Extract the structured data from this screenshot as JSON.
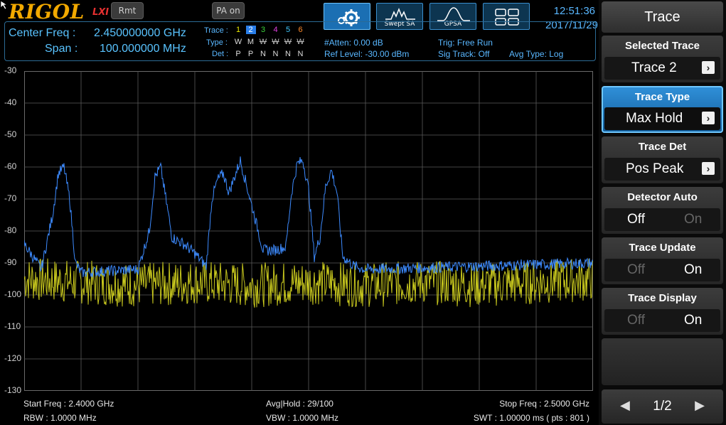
{
  "header": {
    "brand": "RIGOL",
    "lxi": "LXI",
    "rmt_label": "Rmt",
    "pa_label": "PA on",
    "modes": [
      {
        "label": "",
        "icon": "gear-icon"
      },
      {
        "label": "Swept SA",
        "icon": "swept-sa-icon"
      },
      {
        "label": "GPSA",
        "icon": "gpsa-icon"
      },
      {
        "label": "",
        "icon": "layout-icon"
      }
    ],
    "time": "12:51:36",
    "date": "2017/11/29"
  },
  "info": {
    "center_freq_label": "Center Freq :",
    "center_freq_value": "2.450000000 GHz",
    "span_label": "Span :",
    "span_value": "100.000000 MHz",
    "trace_label": "Trace :",
    "type_label": "Type :",
    "det_label": "Det :",
    "trace_numbers": [
      "1",
      "2",
      "3",
      "4",
      "5",
      "6"
    ],
    "trace_colors": [
      "#e8e800",
      "#2a7ee8",
      "#3bd43b",
      "#e040e0",
      "#40c8ff",
      "#ff8a2a"
    ],
    "selected_trace_index": 1,
    "types": [
      "W",
      "M",
      "W",
      "W",
      "W",
      "W"
    ],
    "type_struck": [
      false,
      false,
      true,
      true,
      true,
      true
    ],
    "dets": [
      "P",
      "P",
      "N",
      "N",
      "N",
      "N"
    ],
    "atten": "#Atten: 0.00 dB",
    "ref_level": "Ref Level: -30.00 dBm",
    "trig": "Trig: Free Run",
    "sig_track": "Sig Track: Off",
    "avg_type": "Avg Type: Log"
  },
  "plot": {
    "y_labels": [
      "-30",
      "-40",
      "-50",
      "-60",
      "-70",
      "-80",
      "-90",
      "-100",
      "-110",
      "-120",
      "-130"
    ]
  },
  "footer": {
    "start_freq": "Start Freq : 2.4000 GHz",
    "rbw": "RBW : 1.0000 MHz",
    "avg_hold": "Avg|Hold : 29/100",
    "vbw": "VBW : 1.0000 MHz",
    "stop_freq": "Stop Freq : 2.5000 GHz",
    "swt": "SWT : 1.00000 ms ( pts : 801 )"
  },
  "menu": {
    "title": "Trace",
    "selected_trace_label": "Selected Trace",
    "selected_trace_value": "Trace 2",
    "trace_type_label": "Trace Type",
    "trace_type_value": "Max Hold",
    "trace_det_label": "Trace Det",
    "trace_det_value": "Pos Peak",
    "detector_auto_label": "Detector Auto",
    "detector_auto_off": "Off",
    "detector_auto_on": "On",
    "trace_update_label": "Trace Update",
    "trace_update_off": "Off",
    "trace_update_on": "On",
    "trace_display_label": "Trace Display",
    "trace_display_off": "Off",
    "trace_display_on": "On",
    "page": "1/2"
  },
  "colors": {
    "accent": "#59b7ff",
    "trace1": "#c8c81e",
    "trace2": "#3d8bff",
    "grid": "#5a5a5a"
  },
  "chart_data": {
    "type": "line",
    "x_start_ghz": 2.4,
    "x_stop_ghz": 2.5,
    "ylim": [
      -130,
      -30
    ],
    "y_unit": "dBm",
    "points": 801,
    "grid": true,
    "series": [
      {
        "name": "Trace 1",
        "mode": "W",
        "color": "#c8c81e",
        "x": [
          2.4,
          2.41,
          2.42,
          2.43,
          2.44,
          2.45,
          2.46,
          2.47,
          2.48,
          2.49,
          2.5
        ],
        "y": [
          -95,
          -96,
          -97,
          -96,
          -97,
          -96,
          -97,
          -96,
          -97,
          -96,
          -95
        ]
      },
      {
        "name": "Trace 2",
        "mode": "M",
        "color": "#3d8bff",
        "x": [
          2.4,
          2.403,
          2.405,
          2.406,
          2.407,
          2.408,
          2.409,
          2.41,
          2.42,
          2.422,
          2.423,
          2.424,
          2.426,
          2.428,
          2.43,
          2.432,
          2.433,
          2.434,
          2.435,
          2.436,
          2.437,
          2.438,
          2.44,
          2.442,
          2.444,
          2.446,
          2.447,
          2.448,
          2.449,
          2.45,
          2.451,
          2.452,
          2.453,
          2.454,
          2.455,
          2.456,
          2.458,
          2.46,
          2.5
        ],
        "y": [
          -84,
          -92,
          -75,
          -62,
          -60,
          -70,
          -90,
          -93,
          -92,
          -80,
          -63,
          -60,
          -82,
          -84,
          -87,
          -91,
          -70,
          -64,
          -62,
          -68,
          -63,
          -58,
          -72,
          -86,
          -86,
          -85,
          -68,
          -59,
          -58,
          -67,
          -88,
          -82,
          -66,
          -61,
          -68,
          -88,
          -91,
          -92,
          -90
        ]
      }
    ]
  }
}
